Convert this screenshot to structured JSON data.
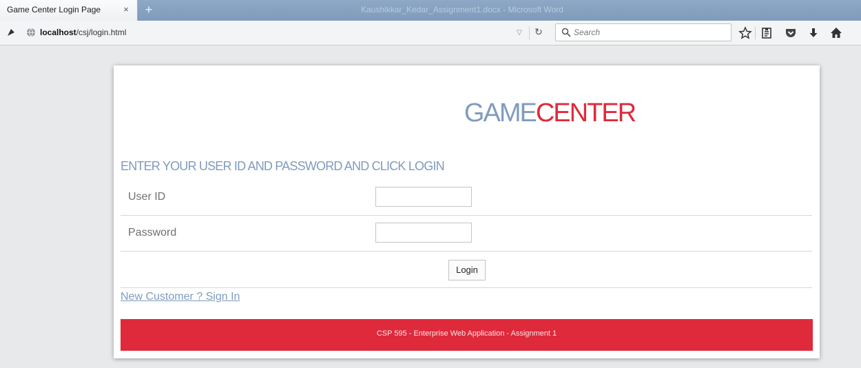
{
  "browser": {
    "tab": {
      "title": "Game Center Login Page",
      "close": "×"
    },
    "new_tab": "+",
    "window_title": "Kaushikkar_Kedar_Assignment1.docx - Microsoft Word",
    "url_host": "localhost",
    "url_path": "/csj/login.html",
    "search_placeholder": "Search",
    "icons": [
      "identity-icon",
      "globe-icon",
      "dropmarker-icon",
      "reload-icon",
      "search-icon",
      "bookmark-star-icon",
      "reading-list-icon",
      "pocket-icon",
      "download-icon",
      "home-icon"
    ]
  },
  "page": {
    "logo_part1": "GAME",
    "logo_part2": "CENTER",
    "instructions": "ENTER YOUR USER ID AND PASSWORD AND CLICK LOGIN",
    "user_id_label": "User ID",
    "user_id_value": "",
    "password_label": "Password",
    "password_value": "",
    "login_label": "Login",
    "signin_link": "New Customer ? Sign In",
    "footer": "CSP 595 - Enterprise Web Application - Assignment 1"
  },
  "colors": {
    "accent_blue": "#7f9bbe",
    "accent_red": "#de2a3b",
    "page_background": "#e8e9ea"
  }
}
